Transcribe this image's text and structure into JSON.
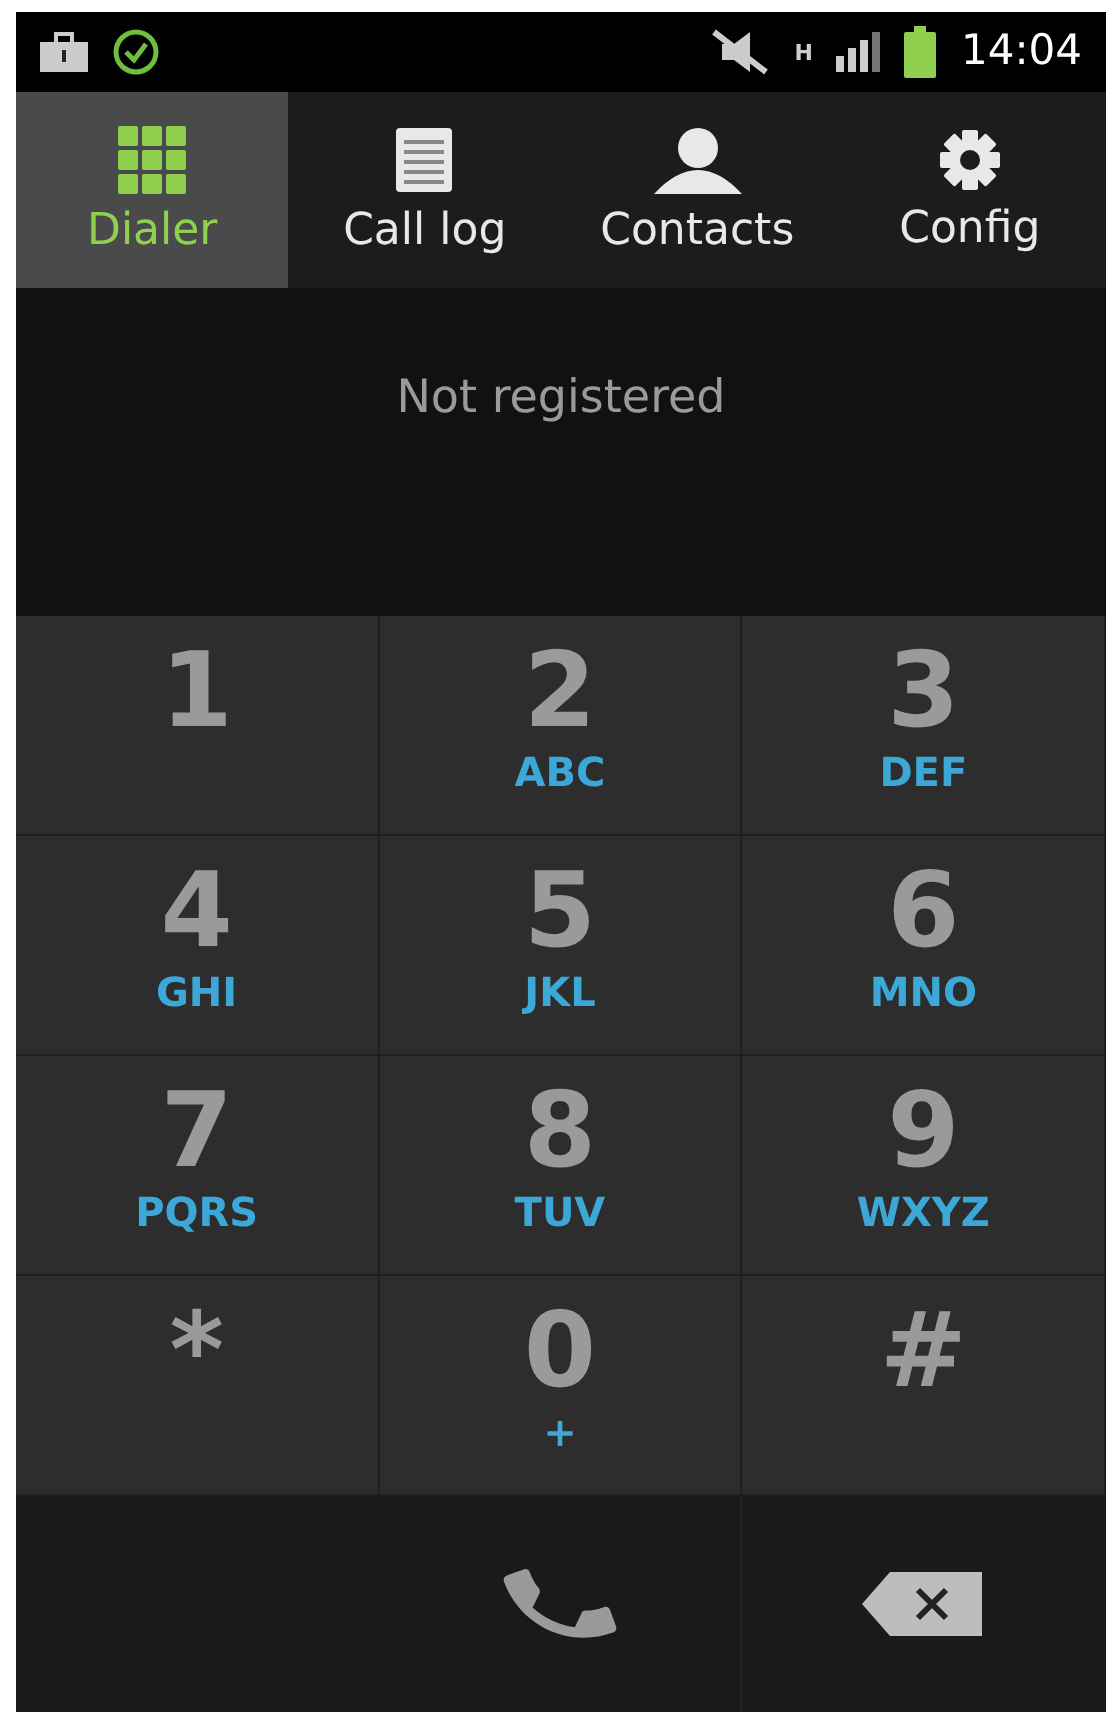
{
  "status_bar": {
    "time": "14:04",
    "network": "H"
  },
  "tabs": [
    {
      "label": "Dialer",
      "kind": "dialer",
      "selected": true
    },
    {
      "label": "Call log",
      "kind": "log",
      "selected": false
    },
    {
      "label": "Contacts",
      "kind": "contacts",
      "selected": false
    },
    {
      "label": "Config",
      "kind": "config",
      "selected": false
    }
  ],
  "display": {
    "status": "Not registered"
  },
  "keys": [
    {
      "digit": "1"
    },
    {
      "digit": "2",
      "letters": "ABC"
    },
    {
      "digit": "3",
      "letters": "DEF"
    },
    {
      "digit": "4",
      "letters": "GHI"
    },
    {
      "digit": "5",
      "letters": "JKL"
    },
    {
      "digit": "6",
      "letters": "MNO"
    },
    {
      "digit": "7",
      "letters": "PQRS"
    },
    {
      "digit": "8",
      "letters": "TUV"
    },
    {
      "digit": "9",
      "letters": "WXYZ"
    },
    {
      "digit": "*"
    },
    {
      "digit": "0",
      "letters": "+"
    },
    {
      "digit": "#"
    }
  ]
}
